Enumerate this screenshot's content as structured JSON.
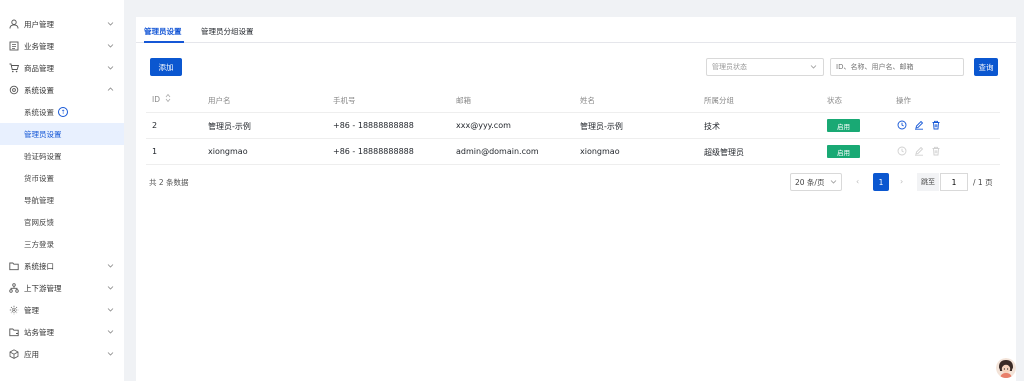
{
  "sidebar": {
    "items": [
      {
        "label": "用户管理",
        "icon": "user-icon",
        "chevron": "down"
      },
      {
        "label": "业务管理",
        "icon": "list-icon",
        "chevron": "down"
      },
      {
        "label": "商品管理",
        "icon": "cart-icon",
        "chevron": "down"
      },
      {
        "label": "系统设置",
        "icon": "gear-icon",
        "chevron": "up"
      },
      {
        "label": "系统接口",
        "icon": "folder-icon",
        "chevron": "down"
      },
      {
        "label": "上下游管理",
        "icon": "hierarchy-icon",
        "chevron": "down"
      },
      {
        "label": "管理",
        "icon": "grid-icon",
        "chevron": "down"
      },
      {
        "label": "站务管理",
        "icon": "folder-open-icon",
        "chevron": "down"
      },
      {
        "label": "应用",
        "icon": "cube-icon",
        "chevron": "down"
      }
    ],
    "sub_items": [
      "系统设置",
      "管理员设置",
      "验证码设置",
      "货币设置",
      "导航管理",
      "官网反馈",
      "三方登录"
    ]
  },
  "tabs": [
    "管理员设置",
    "管理员分组设置"
  ],
  "toolbar": {
    "add_label": "添加",
    "status_placeholder": "管理员状态",
    "search_placeholder": "ID、名称、用户名、邮箱",
    "query_label": "查询"
  },
  "table": {
    "headers": [
      "ID",
      "用户名",
      "手机号",
      "邮箱",
      "姓名",
      "所属分组",
      "状态",
      "操作"
    ],
    "rows": [
      {
        "id": "2",
        "username": "管理员-示例",
        "phone": "+86 - 18888888888",
        "email": "xxx@yyy.com",
        "name": "管理员-示例",
        "group": "技术",
        "status": "启用"
      },
      {
        "id": "1",
        "username": "xiongmao",
        "phone": "+86 - 18888888888",
        "email": "admin@domain.com",
        "name": "xiongmao",
        "group": "超级管理员",
        "status": "启用"
      }
    ]
  },
  "pagination": {
    "total_text": "共 2 条数据",
    "page_size": "20 条/页",
    "current_page": "1",
    "jump_label": "跳至",
    "jump_value": "1",
    "total_pages": "/ 1 页"
  },
  "colors": {
    "accent": "#0b57d0",
    "status_green": "#19a974"
  }
}
